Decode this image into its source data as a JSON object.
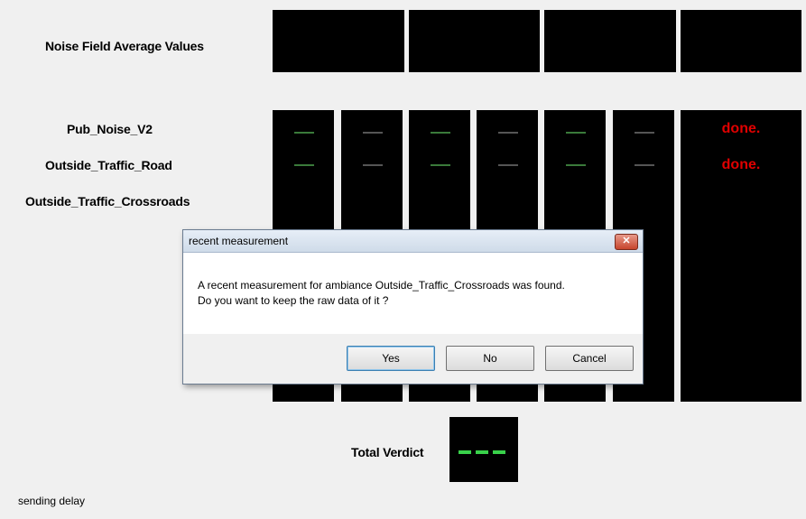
{
  "header_label": "Noise Field Average Values",
  "rows": [
    {
      "label": "Pub_Noise_V2",
      "status": "done."
    },
    {
      "label": "Outside_Traffic_Road",
      "status": "done."
    },
    {
      "label": "Outside_Traffic_Crossroads"
    }
  ],
  "total_verdict_label": "Total Verdict",
  "status_bar": "sending delay",
  "dialog": {
    "title": "recent measurement",
    "close_glyph": "✕",
    "message_line1": "A recent measurement for ambiance Outside_Traffic_Crossroads was found.",
    "message_line2": "Do you want to keep the raw data of it ?",
    "yes": "Yes",
    "no": "No",
    "cancel": "Cancel"
  },
  "colors": {
    "done": "#e00000",
    "dash_green": "#3a7a3a",
    "verdict_dash": "#39d14a",
    "panel": "#000000"
  }
}
